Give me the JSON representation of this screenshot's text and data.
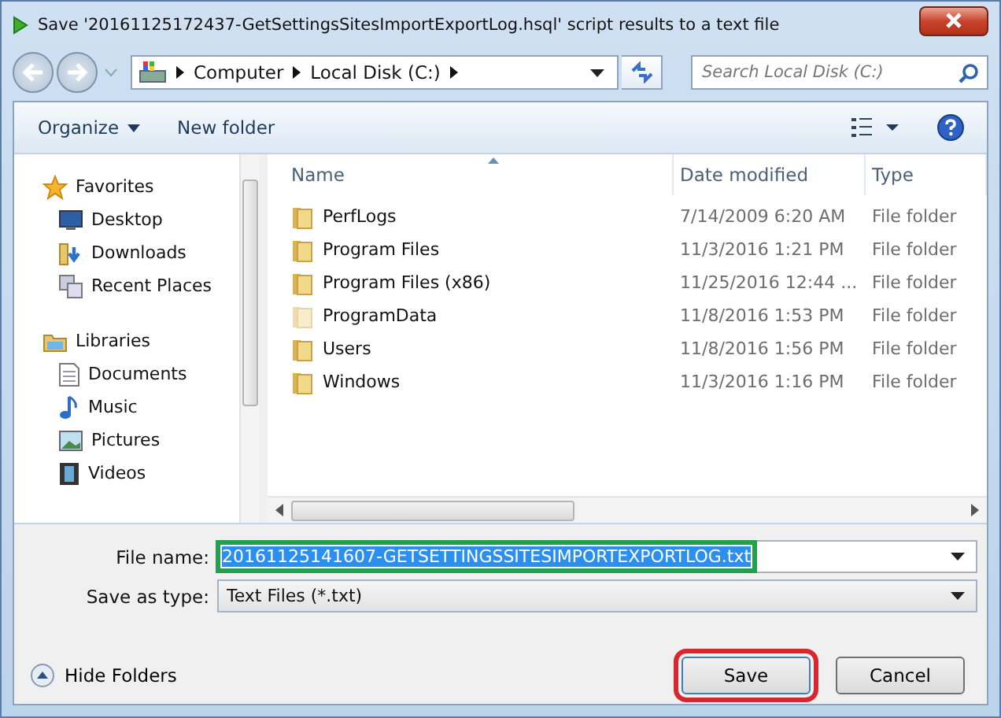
{
  "window": {
    "title": "Save '20161125172437-GetSettingsSitesImportExportLog.hsql' script results to a text file"
  },
  "address": {
    "crumbs": [
      "Computer",
      "Local Disk (C:)"
    ]
  },
  "search": {
    "placeholder": "Search Local Disk (C:)"
  },
  "toolbar": {
    "organize": "Organize",
    "new_folder": "New folder"
  },
  "sidebar": {
    "groups": [
      {
        "label": "Favorites",
        "children": [
          {
            "label": "Desktop"
          },
          {
            "label": "Downloads"
          },
          {
            "label": "Recent Places"
          }
        ]
      },
      {
        "label": "Libraries",
        "children": [
          {
            "label": "Documents"
          },
          {
            "label": "Music"
          },
          {
            "label": "Pictures"
          },
          {
            "label": "Videos"
          }
        ]
      }
    ]
  },
  "table": {
    "columns": [
      "Name",
      "Date modified",
      "Type"
    ],
    "rows": [
      {
        "name": "PerfLogs",
        "date": "7/14/2009 6:20 AM",
        "type": "File folder",
        "hidden": false
      },
      {
        "name": "Program Files",
        "date": "11/3/2016 1:21 PM",
        "type": "File folder",
        "hidden": false
      },
      {
        "name": "Program Files (x86)",
        "date": "11/25/2016 12:44 ...",
        "type": "File folder",
        "hidden": false
      },
      {
        "name": "ProgramData",
        "date": "11/8/2016 1:53 PM",
        "type": "File folder",
        "hidden": true
      },
      {
        "name": "Users",
        "date": "11/8/2016 1:56 PM",
        "type": "File folder",
        "hidden": false
      },
      {
        "name": "Windows",
        "date": "11/3/2016 1:16 PM",
        "type": "File folder",
        "hidden": false
      }
    ]
  },
  "file_name": {
    "label": "File name:",
    "value": "20161125141607-GETSETTINGSSITESIMPORTEXPORTLOG.txt",
    "highlighted": true
  },
  "save_type": {
    "label": "Save as type:",
    "value": "Text Files (*.txt)"
  },
  "hide_folders": "Hide Folders",
  "buttons": [
    {
      "label": "Save",
      "highlighted": true
    },
    {
      "label": "Cancel",
      "highlighted": false
    }
  ]
}
